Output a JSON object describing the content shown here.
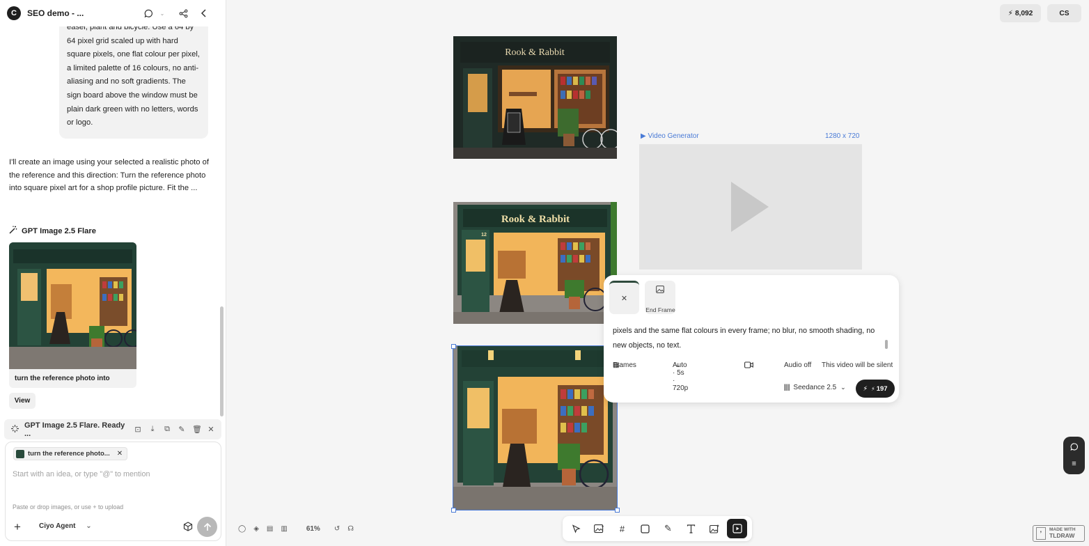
{
  "sidebar": {
    "project_title": "SEO demo - ...",
    "user_message": "easel, plant and bicycle. Use a 64 by 64 pixel grid scaled up with hard square pixels, one flat colour per pixel, a limited palette of 16 colours, no anti-aliasing and no soft gradients. The sign board above the window must be plain dark green with no letters, words or logo.",
    "assistant_message": "I'll create an image using your selected a realistic photo of the reference and this direction: Turn the reference photo into square pixel art for a shop profile picture. Fit the ...",
    "model_label": "GPT Image 2.5 Flare",
    "result_caption": "turn the reference photo into",
    "view_label": "View",
    "status_text": "GPT Image 2.5 Flare. Ready ...",
    "composer": {
      "chip_label": "turn the reference photo...",
      "placeholder": "Start with an idea, or type \"@\" to mention",
      "upload_hint": "Paste or drop images, or use + to upload",
      "agent_label": "Ciyo Agent"
    }
  },
  "topbar": {
    "credits": "8,092",
    "user_initials": "CS"
  },
  "canvas": {
    "shop_name_photo": "Rook & Rabbit",
    "shop_name_pixel": "Rook & Rabbit",
    "door_number": "12",
    "video_generator": {
      "label": "▶ Video Generator",
      "size": "1280 x 720",
      "end_frame_label": "End Frame",
      "prompt_text": "pixels and the same flat colours in every frame; no blur, no smooth shading, no new objects, no text.",
      "frames_label": "Frames",
      "settings_label": "Auto · 5s · 720p",
      "audio_label": "Audio off",
      "silent_note": "This video will be silent",
      "model_label": "Seedance 2.5",
      "cost": "197"
    },
    "zoom": "61%"
  },
  "watermark": {
    "line1": "MADE WITH",
    "line2": "TLDRAW"
  },
  "colors": {
    "accent": "#4a7bd6",
    "shop_green": "#284a3b",
    "dark": "#1f1f1f"
  }
}
